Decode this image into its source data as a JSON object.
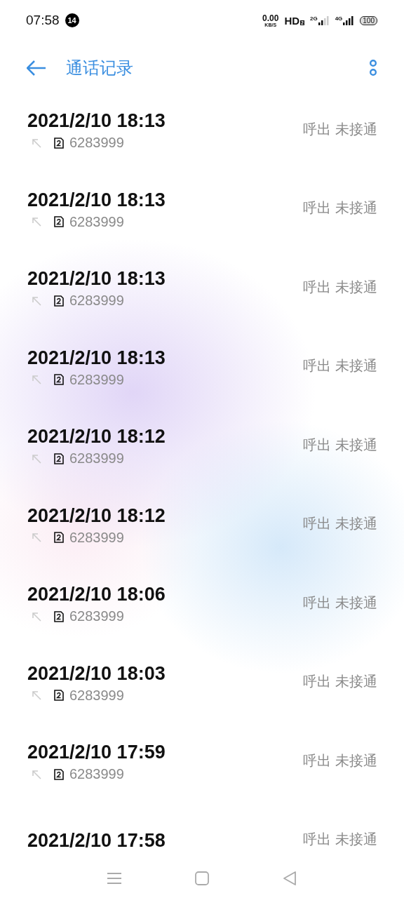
{
  "status_bar": {
    "time": "07:58",
    "notification_count": "14",
    "speed": "0.00",
    "speed_unit": "KB/S",
    "hd": "HD",
    "hd_sim": "2",
    "network_1": "2G",
    "network_2": "4G",
    "battery": "100"
  },
  "header": {
    "title": "通话记录"
  },
  "calls": [
    {
      "datetime": "2021/2/10 18:13",
      "number": "6283999",
      "status": "呼出 未接通"
    },
    {
      "datetime": "2021/2/10 18:13",
      "number": "6283999",
      "status": "呼出 未接通"
    },
    {
      "datetime": "2021/2/10 18:13",
      "number": "6283999",
      "status": "呼出 未接通"
    },
    {
      "datetime": "2021/2/10 18:13",
      "number": "6283999",
      "status": "呼出 未接通"
    },
    {
      "datetime": "2021/2/10 18:12",
      "number": "6283999",
      "status": "呼出 未接通"
    },
    {
      "datetime": "2021/2/10 18:12",
      "number": "6283999",
      "status": "呼出 未接通"
    },
    {
      "datetime": "2021/2/10 18:06",
      "number": "6283999",
      "status": "呼出 未接通"
    },
    {
      "datetime": "2021/2/10 18:03",
      "number": "6283999",
      "status": "呼出 未接通"
    },
    {
      "datetime": "2021/2/10 17:59",
      "number": "6283999",
      "status": "呼出 未接通"
    },
    {
      "datetime": "2021/2/10 17:58",
      "status": "呼出 未接通"
    }
  ]
}
